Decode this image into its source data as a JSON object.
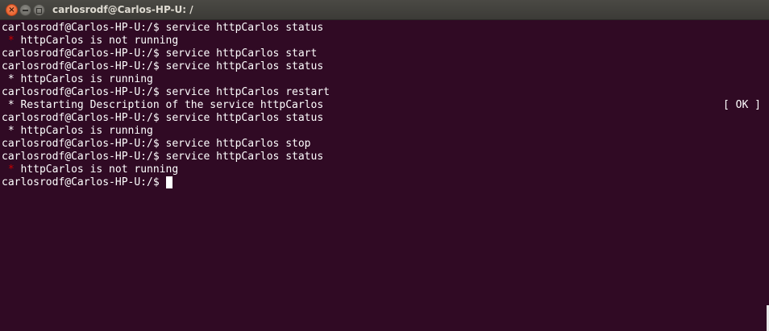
{
  "window": {
    "title": "carlosrodf@Carlos-HP-U: /",
    "close_glyph": "×",
    "colors": {
      "background": "#300a24",
      "text": "#ffffff",
      "error_star": "#cc0000",
      "titlebar": "#3c3b37",
      "close_button": "#e4551f"
    }
  },
  "terminal": {
    "lines": [
      {
        "prompt": "carlosrodf@Carlos-HP-U:/$ ",
        "command": "service httpCarlos status"
      },
      {
        "star": " * ",
        "text": "httpCarlos is not running"
      },
      {
        "prompt": "carlosrodf@Carlos-HP-U:/$ ",
        "command": "service httpCarlos start"
      },
      {
        "prompt": "carlosrodf@Carlos-HP-U:/$ ",
        "command": "service httpCarlos status"
      },
      {
        "star": " * ",
        "text": "httpCarlos is running"
      },
      {
        "prompt": "carlosrodf@Carlos-HP-U:/$ ",
        "command": "service httpCarlos restart"
      },
      {
        "star": " * ",
        "text": "Restarting Description of the service httpCarlos",
        "status": "[ OK ]"
      },
      {
        "prompt": "carlosrodf@Carlos-HP-U:/$ ",
        "command": "service httpCarlos status"
      },
      {
        "star": " * ",
        "text": "httpCarlos is running"
      },
      {
        "prompt": "carlosrodf@Carlos-HP-U:/$ ",
        "command": "service httpCarlos stop"
      },
      {
        "prompt": "carlosrodf@Carlos-HP-U:/$ ",
        "command": "service httpCarlos status"
      },
      {
        "star": " * ",
        "text": "httpCarlos is not running"
      },
      {
        "prompt": "carlosrodf@Carlos-HP-U:/$ ",
        "command": ""
      }
    ]
  }
}
